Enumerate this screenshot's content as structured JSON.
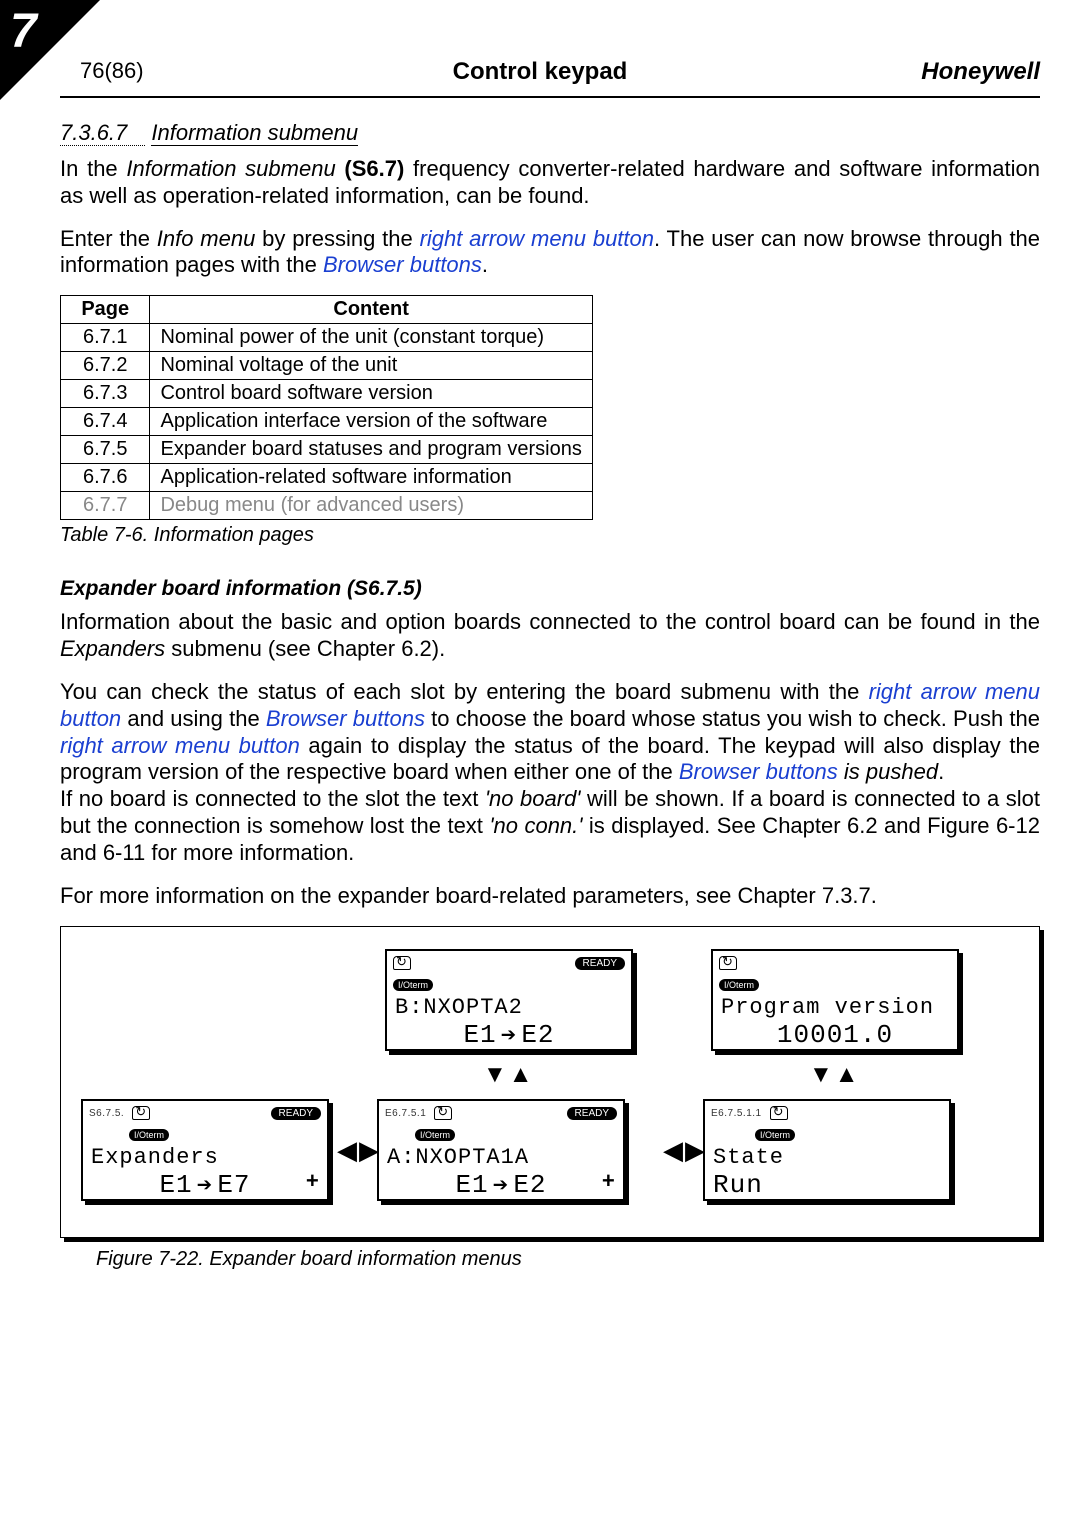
{
  "header": {
    "chapter_tab": "7",
    "page_num": "76(86)",
    "title": "Control keypad",
    "brand": "Honeywell"
  },
  "section": {
    "num": "7.3.6.7",
    "title": "Information submenu"
  },
  "para1": {
    "pre": "In the ",
    "em1": "Information submenu ",
    "bold": "(S6.7) ",
    "rest": "frequency converter-related hardware and software information as well as operation-related information, can be found."
  },
  "para2": {
    "pre": "Enter the ",
    "em1": "Info menu ",
    "mid1": "by pressing the ",
    "link1": "right arrow menu button",
    "mid2": ". The user can now browse through the information pages with the ",
    "link2": "Browser buttons",
    "end": "."
  },
  "table": {
    "headers": {
      "page": "Page",
      "content": "Content"
    },
    "rows": [
      {
        "page": "6.7.1",
        "content": "Nominal power of the unit (constant torque)"
      },
      {
        "page": "6.7.2",
        "content": "Nominal voltage of the unit"
      },
      {
        "page": "6.7.3",
        "content": "Control board software version"
      },
      {
        "page": "6.7.4",
        "content": "Application interface version of the software"
      },
      {
        "page": "6.7.5",
        "content": "Expander board statuses and program versions"
      },
      {
        "page": "6.7.6",
        "content": "Application-related software information"
      },
      {
        "page": "6.7.7",
        "content": "Debug menu (for advanced users)"
      }
    ],
    "caption": "Table 7-6. Information pages"
  },
  "sub": {
    "heading": "Expander board information (S6.7.5)",
    "p1": {
      "pre": "Information about the basic and option boards connected to the control board can be found in the ",
      "em": "Expanders",
      "rest": " submenu (see Chapter 6.2)."
    },
    "p2": {
      "a": "You can check the status of each slot by entering the board submenu with the ",
      "l1": "right arrow menu button",
      "b": " and using the ",
      "l2": "Browser buttons",
      "c": " to choose the board whose status you wish to check. Push the ",
      "l3": "right arrow menu button",
      "d": " again to display the status of the board. The keypad will also display the program version of the respective board when either one of the ",
      "l4": "Browser buttons",
      "e_it": " is pushed",
      "e2": "."
    },
    "p3": {
      "a": "If no board is connected to the slot the text ",
      "q1": "'no board'",
      "b": " will be shown. If a board is connected to a slot but the connection is somehow lost the text ",
      "q2": "'no conn.'",
      "c": " is displayed. See Chapter 6.2 and Figure 6-12 and 6-11 for more information."
    },
    "p4": "For more information on the expander board-related parameters, see Chapter 7.3.7."
  },
  "lcd": {
    "ready": "READY",
    "ioterm": "I/Oterm",
    "A": {
      "tiny": "S6.7.5.",
      "line1": "Expanders",
      "l2a": "E1",
      "l2b": "E7"
    },
    "B": {
      "tiny": "E6.7.5.1",
      "line1": "A:NXOPTA1A",
      "l2a": "E1",
      "l2b": "E2"
    },
    "B2": {
      "line1": "B:NXOPTA2",
      "l2a": "E1",
      "l2b": "E2"
    },
    "C": {
      "tiny": "E6.7.5.1.1",
      "line1": "State",
      "line2": "Run"
    },
    "C2": {
      "line1": "Program version",
      "line2": "10001.0"
    }
  },
  "figcaption": "Figure 7-22. Expander board information menus"
}
